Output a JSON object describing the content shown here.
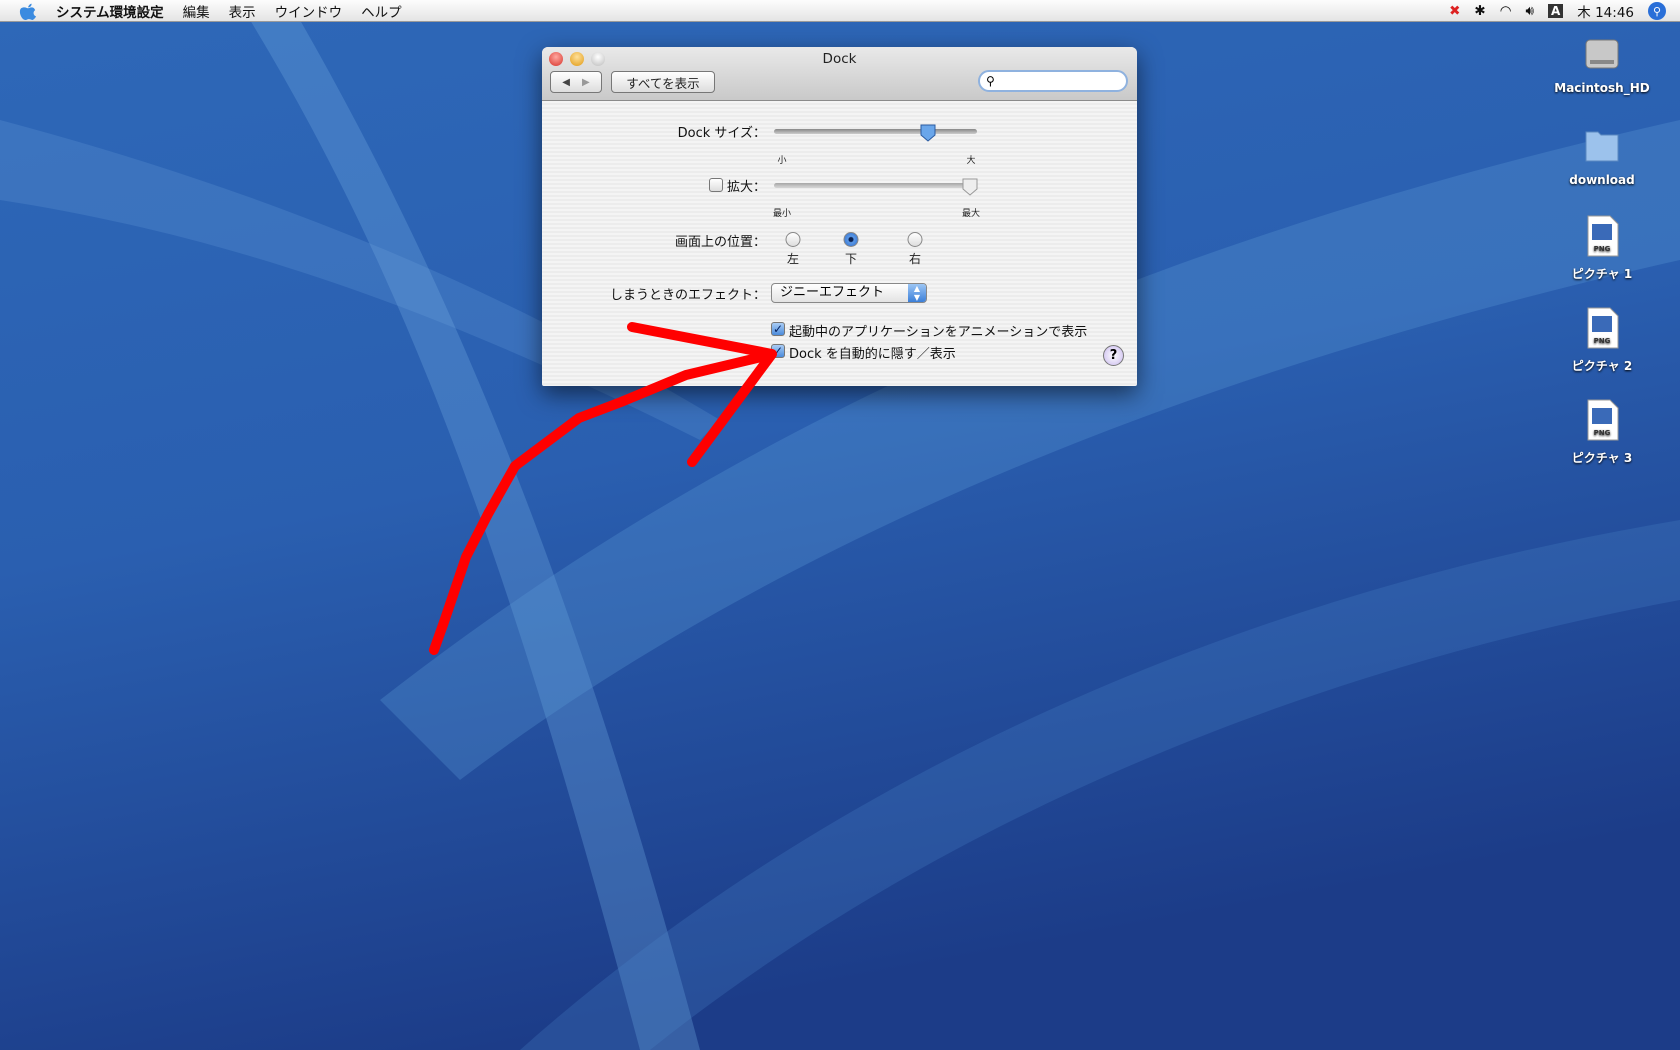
{
  "menubar": {
    "app": "システム環境設定",
    "items": [
      "編集",
      "表示",
      "ウインドウ",
      "ヘルプ"
    ],
    "clock": "木 14:46",
    "input_icon": "A"
  },
  "window": {
    "title": "Dock",
    "show_all": "すべてを表示",
    "search_placeholder": "",
    "dock_size": {
      "label": "Dock サイズ：",
      "min": "小",
      "max": "大",
      "value": 0.82
    },
    "magnification": {
      "label": "拡大：",
      "checked": false,
      "min": "最小",
      "max": "最大",
      "value": 1.0
    },
    "position": {
      "label": "画面上の位置：",
      "options": [
        "左",
        "下",
        "右"
      ],
      "selected": "下"
    },
    "effect": {
      "label": "しまうときのエフェクト：",
      "value": "ジニーエフェクト"
    },
    "animate": {
      "label": "起動中のアプリケーションをアニメーションで表示",
      "checked": true
    },
    "autohide": {
      "label": "Dock を自動的に隠す／表示",
      "checked": true
    },
    "help": "?"
  },
  "desktop": {
    "icons": [
      "Macintosh_HD",
      "download",
      "ピクチャ 1",
      "ピクチャ 2",
      "ピクチャ 3"
    ],
    "png": "PNG"
  },
  "colors": {
    "annotation": "#ff0000"
  }
}
